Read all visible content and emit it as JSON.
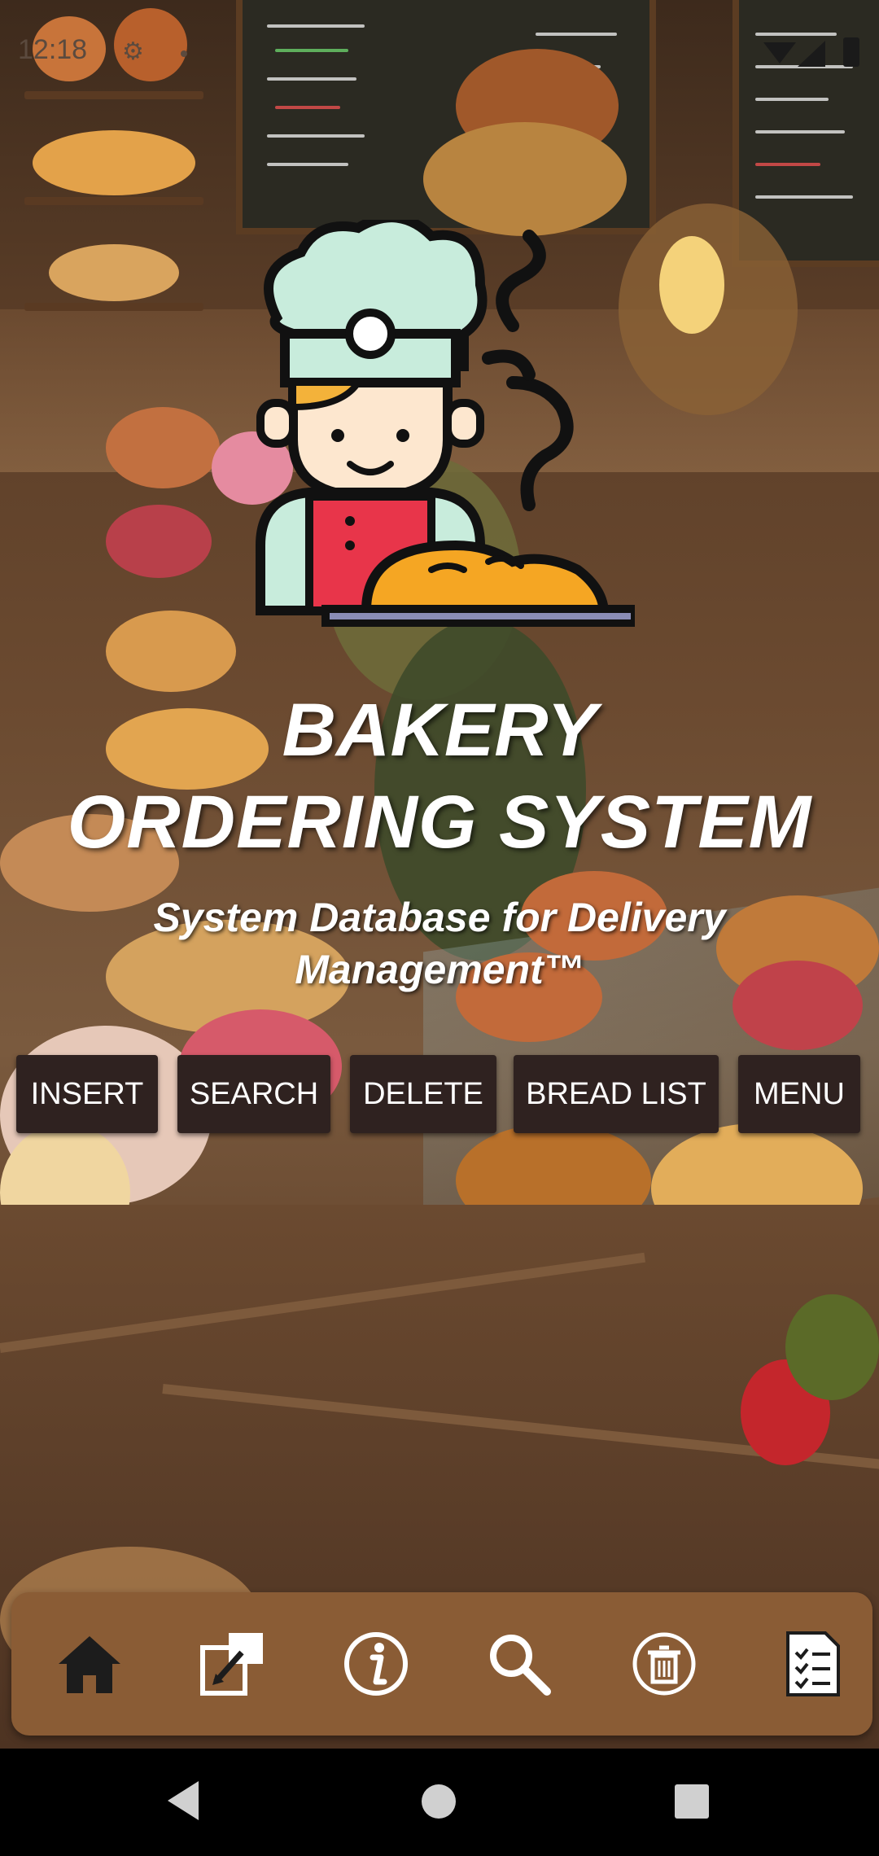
{
  "status_bar": {
    "time": "12:18"
  },
  "app": {
    "title_line1": "BAKERY",
    "title_line2": "ORDERING SYSTEM",
    "subtitle": "System Database for Delivery Management™"
  },
  "actions": {
    "insert": "INSERT",
    "search": "SEARCH",
    "delete": "DELETE",
    "bread_list": "BREAD LIST",
    "menu": "MENU"
  },
  "bottom_nav": {
    "items": [
      "home-icon",
      "edit-icon",
      "info-icon",
      "search-icon",
      "trash-icon",
      "list-icon"
    ],
    "background": "#8a5c35"
  },
  "colors": {
    "button_bg": "#2f2220",
    "button_text": "#ffffff",
    "title_text": "#ffffff"
  }
}
